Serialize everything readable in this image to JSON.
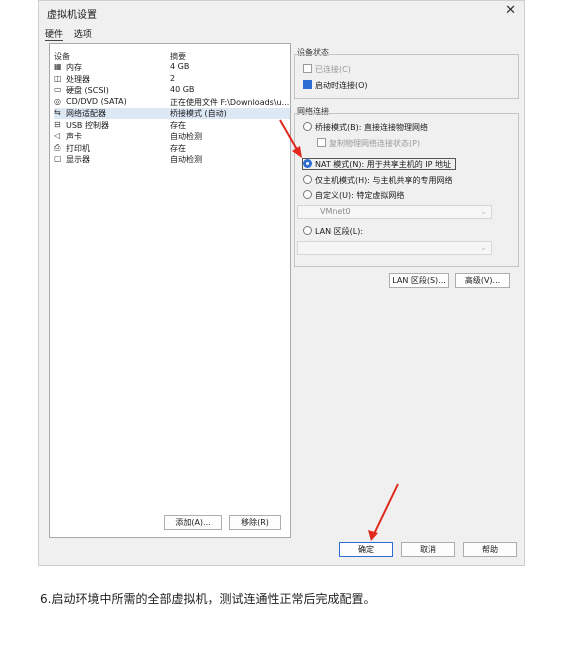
{
  "window": {
    "title": "虚拟机设置",
    "close_glyph": "✕"
  },
  "tabs": [
    "硬件",
    "选项"
  ],
  "device_list": {
    "headers": {
      "device": "设备",
      "summary": "摘要"
    },
    "rows": [
      {
        "icon": "memory-icon",
        "glyph": "▦",
        "name": "内存",
        "summary": "4 GB"
      },
      {
        "icon": "processor-icon",
        "glyph": "◫",
        "name": "处理器",
        "summary": "2"
      },
      {
        "icon": "disk-icon",
        "glyph": "▭",
        "name": "硬盘 (SCSI)",
        "summary": "40 GB"
      },
      {
        "icon": "cd-icon",
        "glyph": "◎",
        "name": "CD/DVD (SATA)",
        "summary": "正在使用文件 F:\\Downloads\\u..."
      },
      {
        "icon": "network-icon",
        "glyph": "⇆",
        "name": "网络适配器",
        "summary": "桥接模式 (自动)",
        "selected": true
      },
      {
        "icon": "usb-icon",
        "glyph": "⊟",
        "name": "USB 控制器",
        "summary": "存在"
      },
      {
        "icon": "sound-icon",
        "glyph": "◁",
        "name": "声卡",
        "summary": "自动检测"
      },
      {
        "icon": "printer-icon",
        "glyph": "⎙",
        "name": "打印机",
        "summary": "存在"
      },
      {
        "icon": "display-icon",
        "glyph": "▢",
        "name": "显示器",
        "summary": "自动检测"
      }
    ],
    "add_button": "添加(A)...",
    "remove_button": "移除(R)"
  },
  "device_status": {
    "label": "设备状态",
    "connected": {
      "label": "已连接(C)",
      "checked": false,
      "disabled": true
    },
    "connect_on_start": {
      "label": "启动时连接(O)",
      "checked": true
    }
  },
  "network": {
    "label": "网络连接",
    "bridged": "桥接模式(B): 直接连接物理网络",
    "replicate": "复制物理网络连接状态(P)",
    "nat": "NAT 模式(N): 用于共享主机的 IP 地址",
    "host_only": "仅主机模式(H): 与主机共享的专用网络",
    "custom": "自定义(U): 特定虚拟网络",
    "custom_value": "VMnet0",
    "lan": "LAN 区段(L):",
    "selected": "nat"
  },
  "buttons": {
    "lan_segments": "LAN 区段(S)...",
    "advanced": "高级(V)...",
    "ok": "确定",
    "cancel": "取消",
    "help": "帮助"
  },
  "caption": "6.启动环境中所需的全部虚拟机，测试连通性正常后完成配置。",
  "colors": {
    "accent": "#2b6dd1",
    "arrow": "#e0291c"
  }
}
